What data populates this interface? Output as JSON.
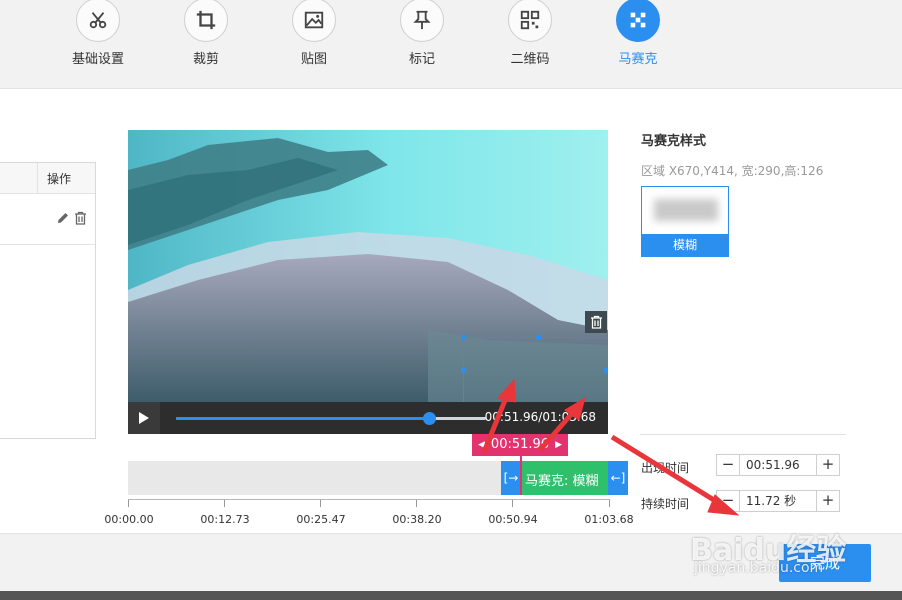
{
  "toolbar": {
    "tools": [
      {
        "label": "基础设置",
        "icon": "scissors-icon"
      },
      {
        "label": "裁剪",
        "icon": "crop-icon"
      },
      {
        "label": "贴图",
        "icon": "image-icon"
      },
      {
        "label": "标记",
        "icon": "pin-icon"
      },
      {
        "label": "二维码",
        "icon": "qrcode-icon"
      },
      {
        "label": "马赛克",
        "icon": "mosaic-icon",
        "active": true
      }
    ]
  },
  "layers": {
    "header_op": "操作"
  },
  "player": {
    "time_display": "00:51.96/01:03.68",
    "progress": 0.815
  },
  "timeline": {
    "playhead_time": "00:51.96",
    "clip_label": "马赛克: 模糊",
    "ticks": [
      "00:00.00",
      "00:12.73",
      "00:25.47",
      "00:38.20",
      "00:50.94",
      "01:03.68"
    ]
  },
  "properties": {
    "title": "马赛克样式",
    "region_info": "区域 X670,Y414,  宽:290,高:126",
    "style_option": "模糊",
    "appear_label": "出现时间",
    "appear_value": "00:51.96",
    "duration_label": "持续时间",
    "duration_value": "11.72 秒"
  },
  "footer": {
    "done_label": "完成"
  },
  "watermark": {
    "text": "Baidu经验",
    "sub": "jingyan.baidu.com"
  },
  "colors": {
    "accent": "#2b8ff0",
    "playhead": "#e2336e",
    "clip": "#2ec06b",
    "annotation_arrow": "#e8363b"
  }
}
